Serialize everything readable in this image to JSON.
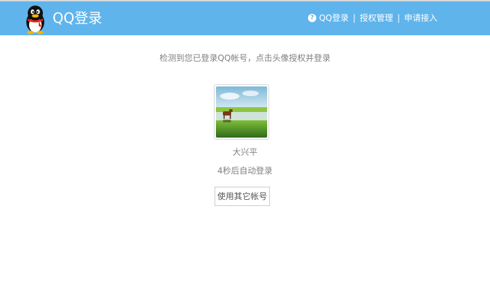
{
  "header": {
    "title": "QQ登录",
    "nav": {
      "qq_login": "QQ登录",
      "auth_manage": "授权管理",
      "apply_access": "申请接入",
      "separator": "|"
    }
  },
  "main": {
    "notice": "检测到您已登录QQ帐号，点击头像授权并登录",
    "nickname": "大兴平",
    "countdown": "4秒后自动登录",
    "other_account_button": "使用其它帐号"
  },
  "colors": {
    "header_bg": "#5fb4ec",
    "text_gray": "#808080"
  },
  "icons": {
    "logo": "qq-penguin-icon",
    "help": "question-circle-icon"
  }
}
